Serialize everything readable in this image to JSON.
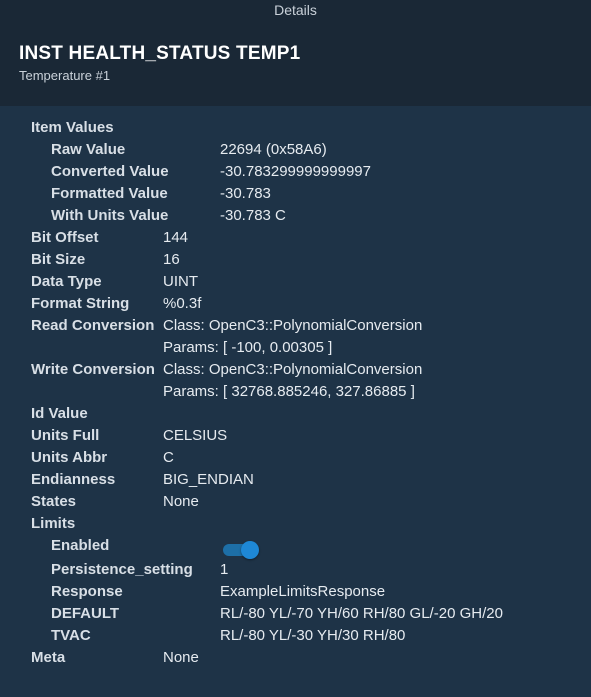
{
  "window": {
    "title": "Details"
  },
  "header": {
    "title": "INST HEALTH_STATUS TEMP1",
    "subtitle": "Temperature #1"
  },
  "item_values": {
    "label": "Item Values",
    "raw_label": "Raw Value",
    "raw": "22694 (0x58A6)",
    "converted_label": "Converted Value",
    "converted": "-30.783299999999997",
    "formatted_label": "Formatted Value",
    "formatted": "-30.783",
    "with_units_label": "With Units Value",
    "with_units": "-30.783 C"
  },
  "fields": {
    "bit_offset_label": "Bit Offset",
    "bit_offset": "144",
    "bit_size_label": "Bit Size",
    "bit_size": "16",
    "data_type_label": "Data Type",
    "data_type": "UINT",
    "format_string_label": "Format String",
    "format_string": "%0.3f",
    "read_conversion_label": "Read Conversion",
    "read_conversion_class": "Class: OpenC3::PolynomialConversion",
    "read_conversion_params": "Params: [ -100, 0.00305 ]",
    "write_conversion_label": "Write Conversion",
    "write_conversion_class": "Class: OpenC3::PolynomialConversion",
    "write_conversion_params": "Params: [ 32768.885246, 327.86885 ]",
    "id_value_label": "Id Value",
    "units_full_label": "Units Full",
    "units_full": "CELSIUS",
    "units_abbr_label": "Units Abbr",
    "units_abbr": "C",
    "endianness_label": "Endianness",
    "endianness": "BIG_ENDIAN",
    "states_label": "States",
    "states": "None"
  },
  "limits": {
    "label": "Limits",
    "enabled_label": "Enabled",
    "enabled": true,
    "persistence_label": "Persistence_setting",
    "persistence": "1",
    "response_label": "Response",
    "response": "ExampleLimitsResponse",
    "default_label": "DEFAULT",
    "default": "RL/-80 YL/-70 YH/60 RH/80 GL/-20 GH/20",
    "tvac_label": "TVAC",
    "tvac": "RL/-80 YL/-30 YH/30 RH/80"
  },
  "meta": {
    "label": "Meta",
    "value": "None"
  },
  "colors": {
    "background": "#1e3347",
    "header": "#1a2836",
    "toggle_accent": "#1e88d6"
  }
}
